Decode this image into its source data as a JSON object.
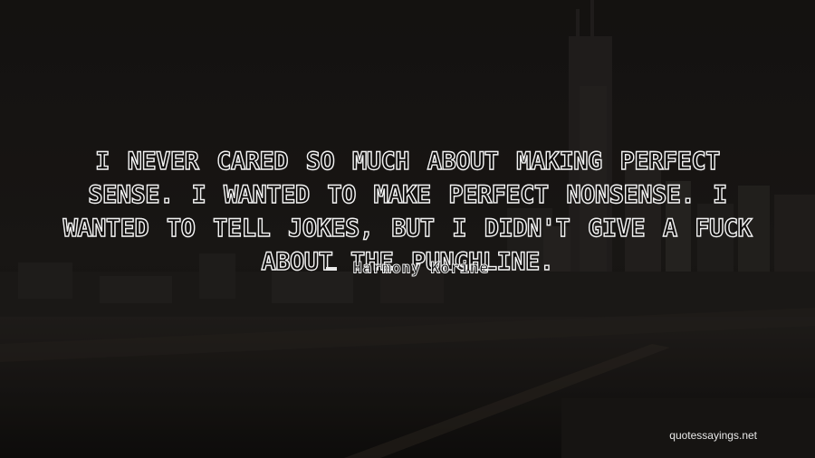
{
  "quote": {
    "text": "I never cared so much about making perfect sense. I wanted to make perfect nonsense. I wanted to tell jokes, but I didn't give a fuck about the punchline.",
    "author": "Harmony Korine"
  },
  "watermark": "quotessayings.net",
  "colors": {
    "text_outline": "#f2f2f2",
    "background": "#1a1715"
  }
}
